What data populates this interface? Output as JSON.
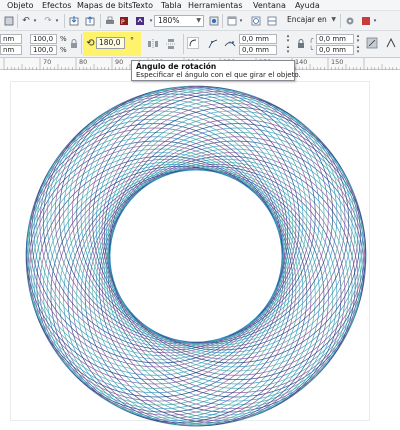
{
  "menu": {
    "items": [
      "Objeto",
      "Efectos",
      "Mapas de bits",
      "Texto",
      "Tabla",
      "Herramientas",
      "Ventana",
      "Ayuda"
    ]
  },
  "toolbar1": {
    "zoom_value": "180%",
    "snap_label": "Encajar en"
  },
  "toolbar2": {
    "width_value": "nm",
    "height_value": "nm",
    "scale_x": "100,0",
    "scale_y": "100,0",
    "percent": "%",
    "rotation_value": "180,0",
    "degree_symbol": "°",
    "outline_a": "0,0 mm",
    "outline_b": "0,0 mm",
    "offset_a": "0,0 mm",
    "offset_b": "0,0 mm"
  },
  "ruler": {
    "labels": [
      "70",
      "80",
      "90",
      "100",
      "110",
      "120",
      "130",
      "140",
      "150"
    ]
  },
  "tooltip": {
    "title": "Ángulo de rotación",
    "description": "Especificar el ángulo con el que girar el objeto."
  },
  "colors": {
    "highlight": "#fff36b",
    "spiro_blue": "#2a8ec4",
    "spiro_teal": "#3aa69a",
    "spiro_purple": "#7a4a9a",
    "spiro_navy": "#1f3f7a"
  }
}
